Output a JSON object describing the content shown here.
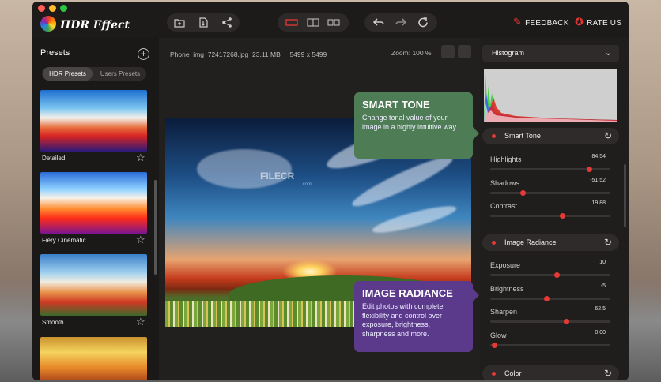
{
  "app": {
    "title": "HDR Effect"
  },
  "toolbar": {
    "feedback": "FEEDBACK",
    "rate": "RATE US"
  },
  "sidebar": {
    "title": "Presets",
    "tabs": [
      "HDR Presets",
      "Users Presets"
    ],
    "presets": [
      {
        "label": "Detailed"
      },
      {
        "label": "Fiery Cinematic"
      },
      {
        "label": "Smooth"
      },
      {
        "label": ""
      }
    ]
  },
  "main": {
    "file_name": "Phone_img_72417268.jpg",
    "file_size": "23.11 MB",
    "separator": "|",
    "dimensions": "5499 x 5499",
    "zoom_label": "Zoom: 100 %",
    "zoom_in": "+",
    "zoom_out": "−",
    "watermark": "FILECR",
    "watermark_sub": ".com"
  },
  "callouts": {
    "smart_tone": {
      "title": "SMART TONE",
      "text": "Change tonal value of your image in a highly intuitive way."
    },
    "image_radiance": {
      "title": "IMAGE RADIANCE",
      "text": "Edit photos with complete flexibility and control over exposure, brightness, sharpness and more."
    }
  },
  "panel": {
    "histogram_label": "Histogram",
    "smart_tone": {
      "title": "Smart Tone",
      "sliders": [
        {
          "label": "Highlights",
          "value": "84.54",
          "level": 0.82
        },
        {
          "label": "Shadows",
          "value": "-51.52",
          "level": 0.27
        },
        {
          "label": "Contrast",
          "value": "19.88",
          "level": 0.6
        }
      ]
    },
    "image_radiance": {
      "title": "Image Radiance",
      "sliders": [
        {
          "label": "Exposure",
          "value": "10",
          "level": 0.55
        },
        {
          "label": "Brightness",
          "value": "-5",
          "level": 0.47
        },
        {
          "label": "Sharpen",
          "value": "62.5",
          "level": 0.63
        },
        {
          "label": "Glow",
          "value": "0.00",
          "level": 0.03
        }
      ]
    },
    "color": {
      "title": "Color"
    }
  },
  "colors": {
    "accent": "#e53935",
    "smart_tone_bg": "#4e7d55",
    "radiance_bg": "#5b3a8c"
  }
}
